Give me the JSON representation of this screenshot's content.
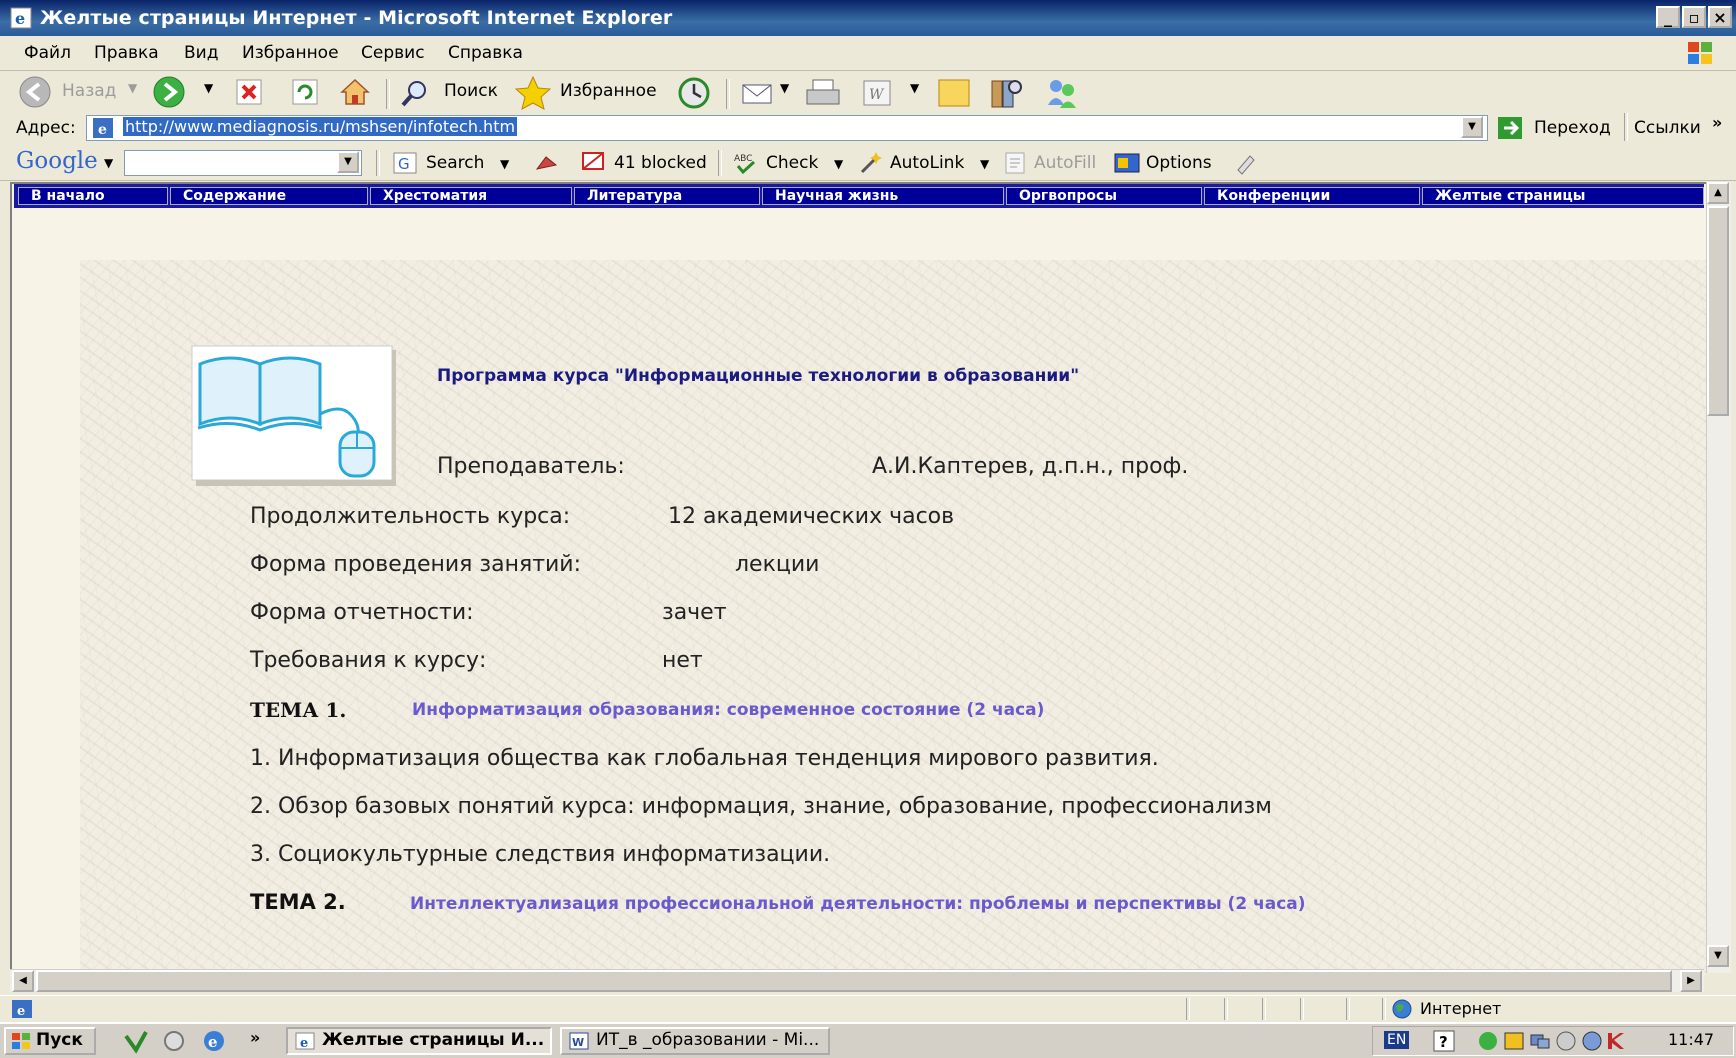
{
  "window": {
    "title": "Желтые страницы Интернет - Microsoft Internet Explorer"
  },
  "menu": [
    "Файл",
    "Правка",
    "Вид",
    "Избранное",
    "Сервис",
    "Справка"
  ],
  "toolbar": {
    "back": "Назад",
    "search": "Поиск",
    "favorites": "Избранное"
  },
  "address": {
    "label": "Адрес:",
    "url": "http://www.mediagnosis.ru/mshsen/infotech.htm",
    "go": "Переход",
    "links": "Ссылки"
  },
  "googlebar": {
    "logo": "Google",
    "search": "Search",
    "blocked": "41 blocked",
    "check": "Check",
    "autolink": "AutoLink",
    "autofill": "AutoFill",
    "options": "Options"
  },
  "site_nav": [
    "В начало",
    "Содержание",
    "Хрестоматия",
    "Литература",
    "Научная жизнь",
    "Оргвопросы",
    "Конференции",
    "Желтые страницы"
  ],
  "content": {
    "heading": "Программа курса \"Информационные технологии в образовании\"",
    "teacher_label": "Преподаватель:",
    "teacher_value": "А.И.Каптерев, д.п.н., проф.",
    "duration_label": "Продолжительность курса:",
    "duration_value": "12 академических часов",
    "form_label": "Форма проведения занятий:",
    "form_value": "лекции",
    "report_label": "Форма отчетности:",
    "report_value": "зачет",
    "req_label": "Требования к курсу:",
    "req_value": "нет",
    "topic1_label": "ТЕМА 1.",
    "topic1_title": "Информатизация образования: современное состояние (2 часа)",
    "items": [
      "1.  Информатизация общества как глобальная тенденция мирового развития.",
      "2.  Обзор базовых понятий курса: информация, знание, образование, профессионализм",
      "3.  Социокультурные следствия информатизации."
    ],
    "topic2_label": "ТЕМА 2.",
    "topic2_title": "Интеллектуализация профессиональной деятельности: проблемы и перспективы (2 часа)"
  },
  "status": {
    "zone": "Интернет"
  },
  "taskbar": {
    "start": "Пуск",
    "task1": "Желтые страницы И...",
    "task2": "ИТ_в _образовании - Mi...",
    "lang": "EN",
    "clock": "11:47"
  }
}
